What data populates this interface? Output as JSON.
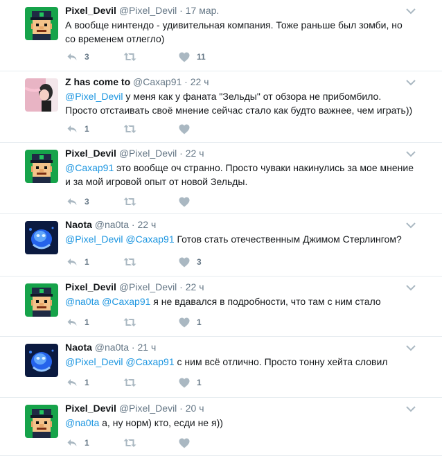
{
  "colors": {
    "accent": "#1b95e0",
    "muted": "#657786",
    "border": "#e6ecf0"
  },
  "tweets": [
    {
      "avatar": "pixel-devil-avatar",
      "name": "Pixel_Devil",
      "handle": "@Pixel_Devil",
      "time": "17 мар.",
      "mentions": [],
      "text": "А вообще нинтендо - удивительная компания. Тоже раньше был зомби, но со временем отлегло)",
      "replies": "3",
      "retweets": "",
      "likes": "11"
    },
    {
      "avatar": "z-has-come-to-avatar",
      "name": "Z has come to",
      "handle": "@Caxap91",
      "time": "22 ч",
      "mentions": [
        "@Pixel_Devil"
      ],
      "text": "у меня как у фаната \"Зельды\" от обзора не прибомбило. Просто отстаивать своё мнение сейчас стало как будто важнее, чем играть))",
      "replies": "1",
      "retweets": "",
      "likes": ""
    },
    {
      "avatar": "pixel-devil-avatar",
      "name": "Pixel_Devil",
      "handle": "@Pixel_Devil",
      "time": "22 ч",
      "mentions": [
        "@Caxap91"
      ],
      "text": "это вообще оч странно. Просто чуваки накинулись за мое мнение и за мой игровой опыт от новой Зельды.",
      "replies": "3",
      "retweets": "",
      "likes": ""
    },
    {
      "avatar": "naota-avatar",
      "name": "Naota",
      "handle": "@na0ta",
      "time": "22 ч",
      "mentions": [
        "@Pixel_Devil",
        "@Caxap91"
      ],
      "text": "Готов стать отечественным Джимом Стерлингом?",
      "replies": "1",
      "retweets": "",
      "likes": "3"
    },
    {
      "avatar": "pixel-devil-avatar",
      "name": "Pixel_Devil",
      "handle": "@Pixel_Devil",
      "time": "22 ч",
      "mentions": [
        "@na0ta",
        "@Caxap91"
      ],
      "text": "я не вдавался в подробности, что там с ним стало",
      "replies": "1",
      "retweets": "",
      "likes": "1"
    },
    {
      "avatar": "naota-avatar",
      "name": "Naota",
      "handle": "@na0ta",
      "time": "21 ч",
      "mentions": [
        "@Pixel_Devil",
        "@Caxap91"
      ],
      "text": "с ним всё отлично. Просто тонну хейта словил",
      "replies": "1",
      "retweets": "",
      "likes": "1"
    },
    {
      "avatar": "pixel-devil-avatar",
      "name": "Pixel_Devil",
      "handle": "@Pixel_Devil",
      "time": "20 ч",
      "mentions": [
        "@na0ta"
      ],
      "text": "а, ну норм) кто, есди не я))",
      "replies": "1",
      "retweets": "",
      "likes": ""
    }
  ]
}
